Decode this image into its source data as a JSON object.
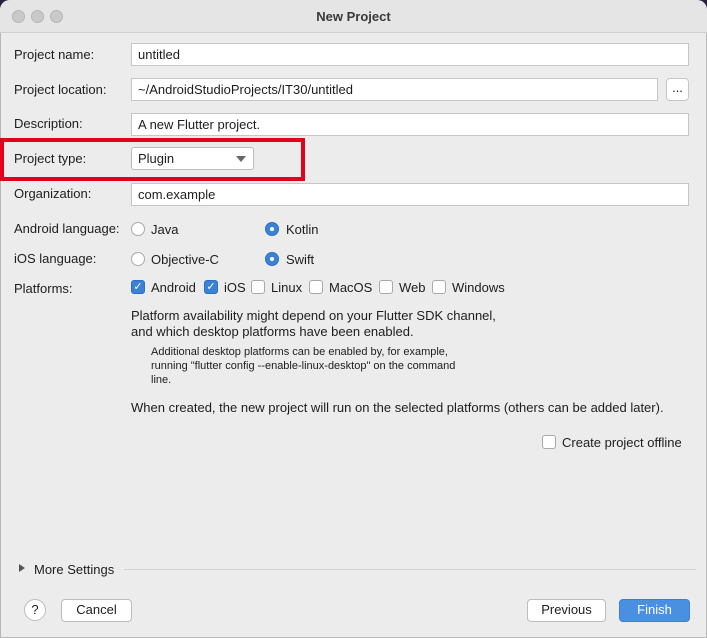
{
  "window": {
    "title": "New Project"
  },
  "form": {
    "project_name": {
      "label": "Project name:",
      "value": "untitled"
    },
    "project_location": {
      "label": "Project location:",
      "value": "~/AndroidStudioProjects/IT30/untitled",
      "browse_label": "..."
    },
    "description": {
      "label": "Description:",
      "value": "A new Flutter project."
    },
    "project_type": {
      "label": "Project type:",
      "value": "Plugin"
    },
    "organization": {
      "label": "Organization:",
      "value": "com.example"
    },
    "android_language": {
      "label": "Android language:",
      "options": [
        "Java",
        "Kotlin"
      ],
      "selected": "Kotlin"
    },
    "ios_language": {
      "label": "iOS language:",
      "options": [
        "Objective-C",
        "Swift"
      ],
      "selected": "Swift"
    },
    "platforms": {
      "label": "Platforms:",
      "items": [
        {
          "label": "Android",
          "checked": true
        },
        {
          "label": "iOS",
          "checked": true
        },
        {
          "label": "Linux",
          "checked": false
        },
        {
          "label": "MacOS",
          "checked": false
        },
        {
          "label": "Web",
          "checked": false
        },
        {
          "label": "Windows",
          "checked": false
        }
      ]
    },
    "availability_line1": "Platform availability might depend on your Flutter SDK channel,",
    "availability_line2": "and which desktop platforms have been enabled.",
    "note_line1": "Additional desktop platforms can be enabled by, for example,",
    "note_line2": "running \"flutter config --enable-linux-desktop\" on the command",
    "note_line3": "line.",
    "created_note": "When created, the new project will run on the selected platforms (others can be added later).",
    "offline": {
      "label": "Create project offline",
      "checked": false
    }
  },
  "more_settings": "More Settings",
  "footer": {
    "help_label": "?",
    "cancel": "Cancel",
    "previous": "Previous",
    "finish": "Finish"
  },
  "colors": {
    "accent": "#3b82d6",
    "highlight": "#e3001b",
    "primary_button": "#4a90e2"
  },
  "check_glyph": "✓"
}
